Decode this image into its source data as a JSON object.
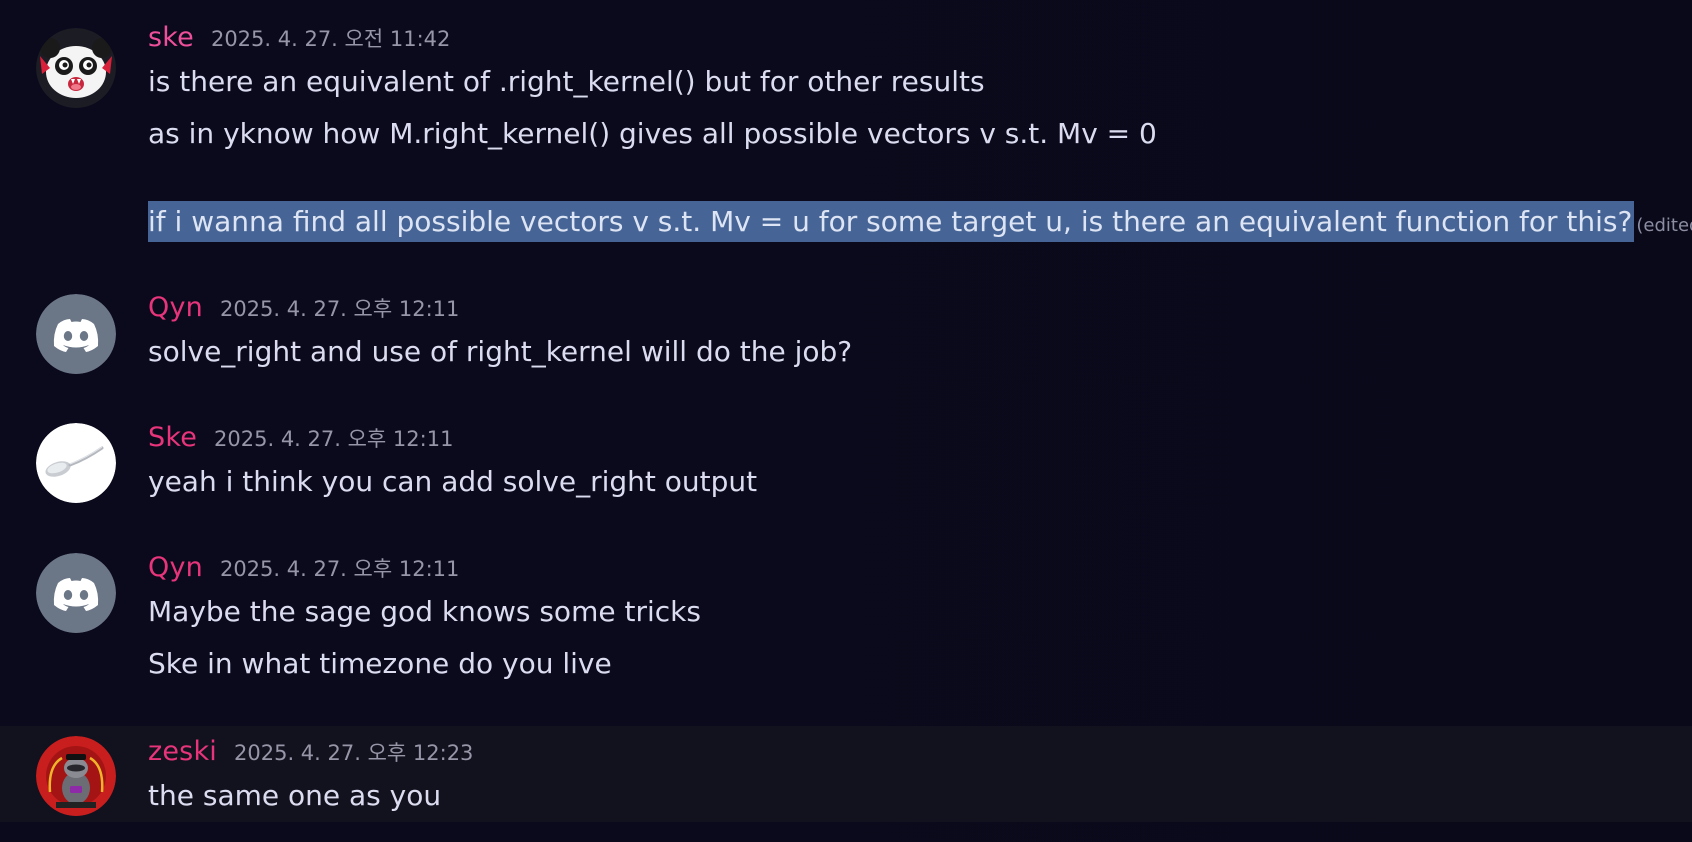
{
  "messages": [
    {
      "username": "ske",
      "timestamp": "2025. 4. 27. 오전 11:42",
      "lines": [
        "is there an equivalent of .right_kernel() but for other results",
        "as in yknow how M.right_kernel() gives all possible vectors v s.t. Mv = 0",
        "if i wanna find all possible vectors v s.t. Mv = u for some target u, is there an equivalent function for this?"
      ],
      "edited_label": "(edited)",
      "avatar": "panda-avatar",
      "username_color": "#ee4f9a"
    },
    {
      "username": "Qyn",
      "timestamp": "2025. 4. 27. 오후 12:11",
      "lines": [
        "solve_right and use of right_kernel will do the job?"
      ],
      "avatar": "discord-default-avatar",
      "username_color": "#e8347a"
    },
    {
      "username": "Ske",
      "timestamp": "2025. 4. 27. 오후 12:11",
      "lines": [
        "yeah i think you can add solve_right output"
      ],
      "avatar": "spoon-avatar",
      "username_color": "#e8347a"
    },
    {
      "username": "Qyn",
      "timestamp": "2025. 4. 27. 오후 12:11",
      "lines": [
        "Maybe the sage god knows some tricks",
        "Ske in what timezone do you live"
      ],
      "avatar": "discord-default-avatar",
      "username_color": "#e8347a"
    },
    {
      "username": "zeski",
      "timestamp": "2025. 4. 27. 오후 12:23",
      "lines": [
        "the same one as you"
      ],
      "avatar": "raccoon-avatar",
      "username_color": "#e8347a"
    }
  ],
  "colors": {
    "background": "#0a0918",
    "selection": "#466596",
    "text": "#dcdcf0",
    "timestamp": "#9696a8"
  }
}
